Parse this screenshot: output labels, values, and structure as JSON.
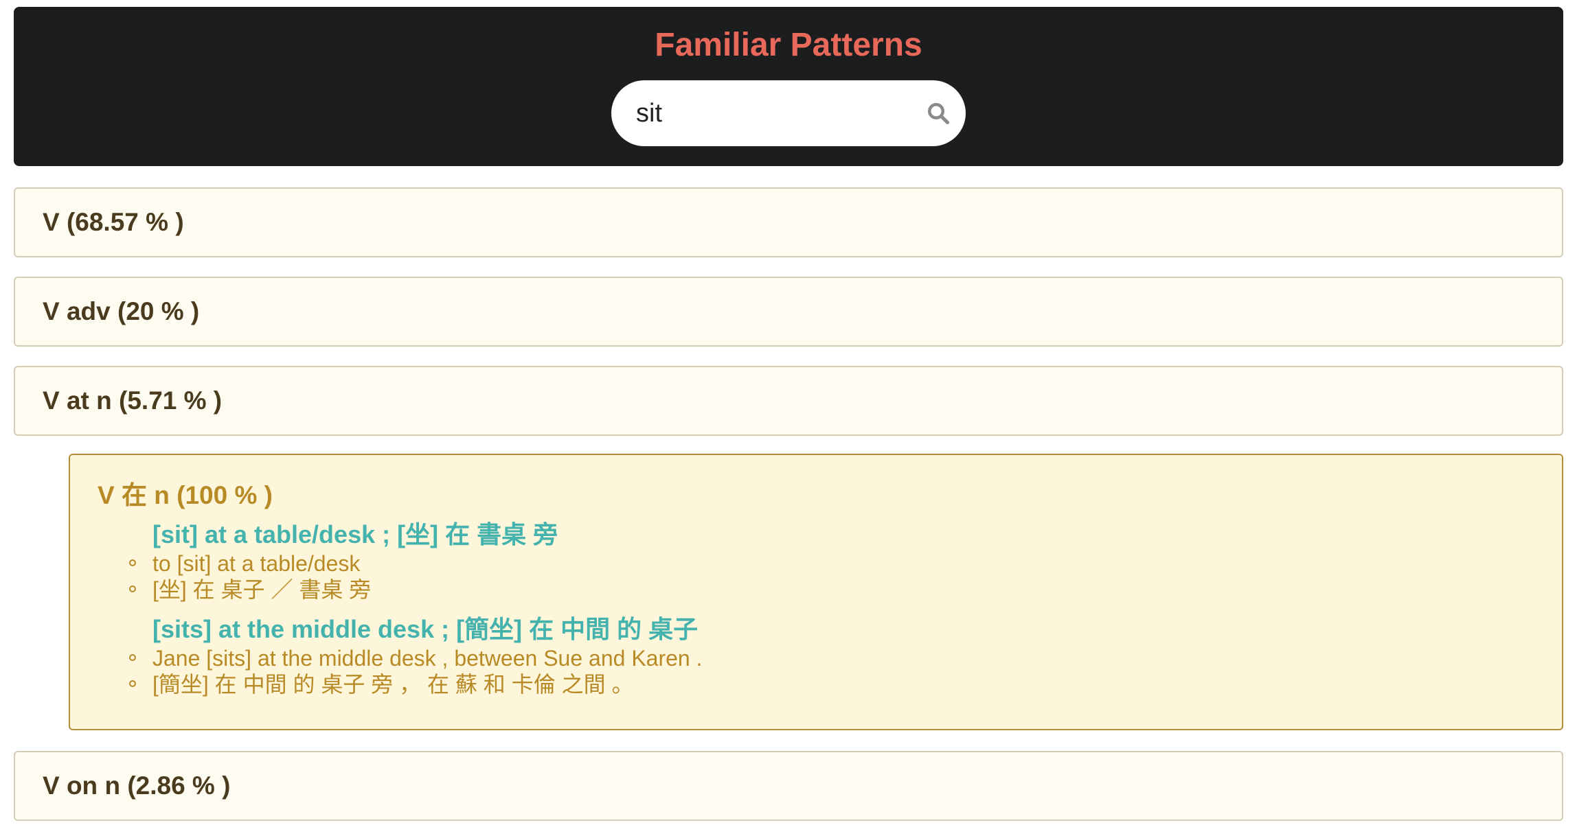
{
  "header": {
    "title": "Familiar Patterns",
    "accent_color": "#e8695a",
    "background_color": "#1c1d1f"
  },
  "search": {
    "value": "sit",
    "icon": "search-icon"
  },
  "patterns": [
    {
      "label": "V (68.57 % )"
    },
    {
      "label": "V adv (20 % )"
    },
    {
      "label": "V at n (5.71 % )"
    },
    {
      "label": "V on n (2.86 % )"
    }
  ],
  "expanded": {
    "title": "V 在 n (100 % )",
    "groups": [
      {
        "heading": "[sit] at a table/desk ; [坐] 在 書桌 旁",
        "examples": [
          "to [sit] at a table/desk",
          "[坐] 在 桌子 ／ 書桌 旁"
        ]
      },
      {
        "heading": "[sits] at the middle desk ; [簡坐] 在 中間 的 桌子",
        "examples": [
          "Jane [sits] at the middle desk , between Sue and Karen .",
          "[簡坐] 在 中間 的 桌子 旁 ， 在 蘇 和 卡倫 之間 。"
        ]
      }
    ]
  }
}
